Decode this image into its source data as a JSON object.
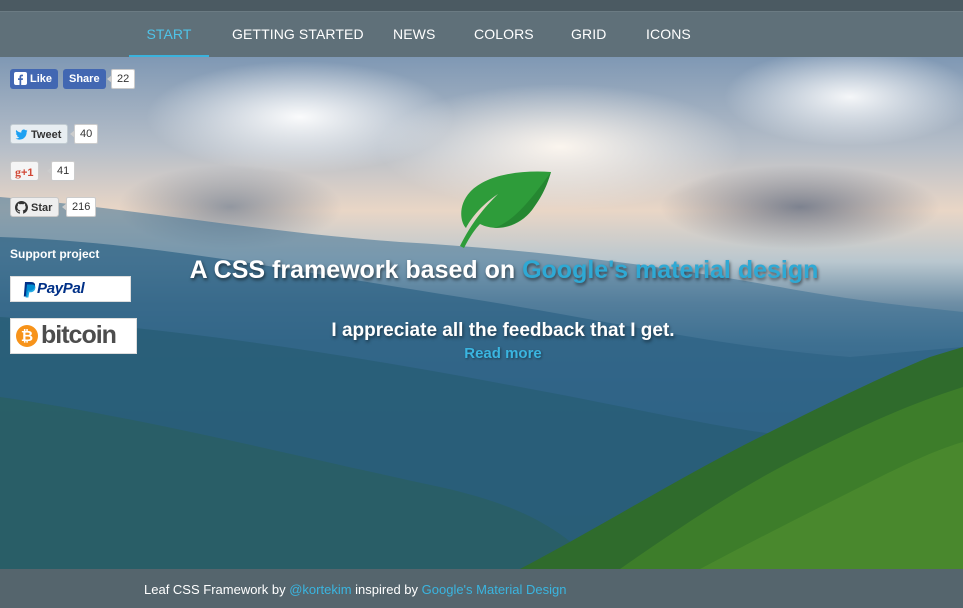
{
  "nav": {
    "items": [
      {
        "label": "START",
        "active": true
      },
      {
        "label": "GETTING STARTED"
      },
      {
        "label": "NEWS"
      },
      {
        "label": "COLORS"
      },
      {
        "label": "GRID"
      },
      {
        "label": "ICONS"
      }
    ]
  },
  "social": {
    "facebook": {
      "like_label": "Like",
      "share_label": "Share",
      "count": "22",
      "icon": "facebook-icon"
    },
    "twitter": {
      "tweet_label": "Tweet",
      "count": "40",
      "icon": "twitter-icon"
    },
    "google_plus": {
      "label": "+1",
      "count": "41",
      "icon": "google-plus-icon"
    },
    "github": {
      "star_label": "Star",
      "count": "216",
      "icon": "github-icon"
    }
  },
  "support": {
    "title": "Support project",
    "paypal_label": "PayPal",
    "bitcoin_label": "bitcoin"
  },
  "hero": {
    "headline_prefix": "A CSS framework based on ",
    "headline_accent": "Google's material design",
    "subline": "I appreciate all the feedback that I get.",
    "read_more": "Read more",
    "logo_icon": "leaf-icon"
  },
  "footer": {
    "prefix": "Leaf CSS Framework by ",
    "author": "@kortekim",
    "middle": " inspired by ",
    "link": "Google's Material Design"
  },
  "colors": {
    "nav_bg": "#5f7079",
    "accent": "#3ab5e0",
    "leaf_green": "#2e9c3a",
    "facebook": "#4267b2",
    "twitter": "#1da1f2",
    "bitcoin": "#f7931a"
  }
}
